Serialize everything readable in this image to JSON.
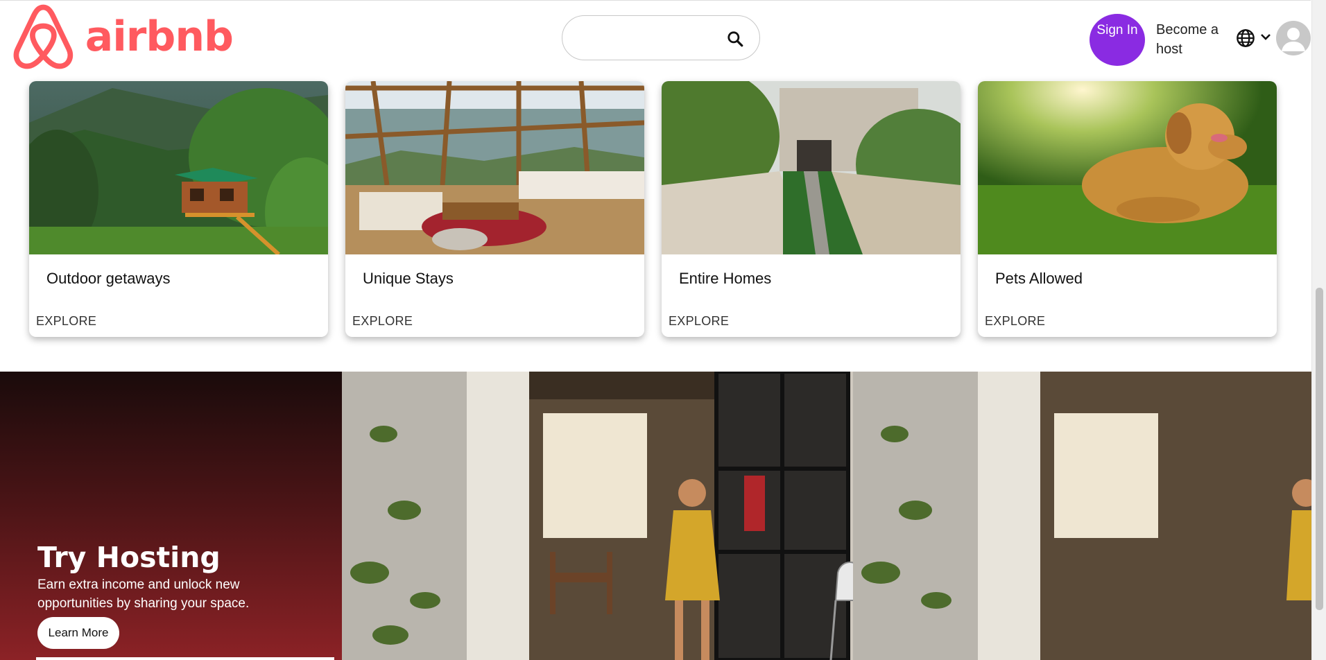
{
  "header": {
    "logo_text": "airbnb",
    "search": {
      "placeholder": "",
      "value": "",
      "icon": "search-icon"
    },
    "sign_in_label": "Sign In",
    "become_host_label": "Become a host",
    "language_icon": "globe-icon",
    "menu_icon": "chevron-down-icon",
    "profile_icon": "user-avatar-icon"
  },
  "categories": [
    {
      "title": "Outdoor getaways",
      "action": "EXPLORE",
      "image": "treehouse-in-forest"
    },
    {
      "title": "Unique Stays",
      "action": "EXPLORE",
      "image": "glass-roof-lounge"
    },
    {
      "title": "Entire Homes",
      "action": "EXPLORE",
      "image": "garden-path-house"
    },
    {
      "title": "Pets Allowed",
      "action": "EXPLORE",
      "image": "golden-retriever-on-grass"
    }
  ],
  "hosting": {
    "title": "Try Hosting",
    "description": "Earn extra income and unlock new opportunities by sharing your space.",
    "button_label": "Learn More",
    "image": "host-standing-in-doorway"
  },
  "colors": {
    "brand": "#ff5a5f",
    "sign_in": "#8a2be2",
    "banner_gradient_top": "#1a0b0b",
    "banner_gradient_bottom": "#8c2226"
  }
}
